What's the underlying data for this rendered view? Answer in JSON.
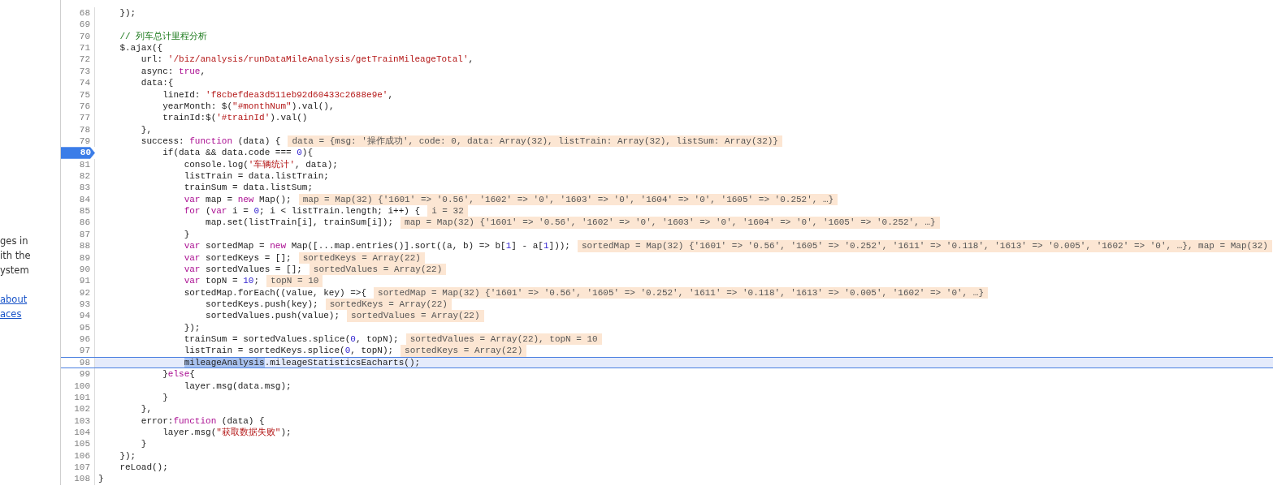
{
  "side_panel": {
    "texts": [
      {
        "kind": "text",
        "text": "ges in"
      },
      {
        "kind": "text",
        "text": "ith the"
      },
      {
        "kind": "text",
        "text": "ystem"
      },
      {
        "kind": "link",
        "text": "about"
      },
      {
        "kind": "link",
        "text": "aces"
      }
    ]
  },
  "editor": {
    "lines": [
      {
        "number": "68",
        "breakpoint": false,
        "current": false,
        "code": [
          {
            "kind": "plain",
            "text": "    });"
          }
        ]
      },
      {
        "number": "69",
        "breakpoint": false,
        "current": false
      },
      {
        "number": "70",
        "breakpoint": false,
        "current": false,
        "code": [
          {
            "kind": "comment",
            "text": "    // 列车总计里程分析"
          }
        ]
      },
      {
        "number": "71",
        "breakpoint": false,
        "current": false,
        "code": [
          {
            "kind": "plain",
            "text": "    $.ajax({"
          }
        ]
      },
      {
        "number": "72",
        "breakpoint": false,
        "current": false,
        "code": [
          {
            "kind": "plain",
            "text": "        url: "
          },
          {
            "kind": "string",
            "text": "'/biz/analysis/runDataMileAnalysis/getTrainMileageTotal'"
          },
          {
            "kind": "plain",
            "text": ","
          }
        ]
      },
      {
        "number": "73",
        "breakpoint": false,
        "current": false,
        "code": [
          {
            "kind": "plain",
            "text": "        async: "
          },
          {
            "kind": "keyword",
            "text": "true"
          },
          {
            "kind": "plain",
            "text": ","
          }
        ]
      },
      {
        "number": "74",
        "breakpoint": false,
        "current": false,
        "code": [
          {
            "kind": "plain",
            "text": "        data:{"
          }
        ]
      },
      {
        "number": "75",
        "breakpoint": false,
        "current": false,
        "code": [
          {
            "kind": "plain",
            "text": "            lineId: "
          },
          {
            "kind": "string",
            "text": "'f8cbefdea3d511eb92d60433c2688e9e'"
          },
          {
            "kind": "plain",
            "text": ","
          }
        ]
      },
      {
        "number": "76",
        "breakpoint": false,
        "current": false,
        "code": [
          {
            "kind": "plain",
            "text": "            yearMonth: $("
          },
          {
            "kind": "string",
            "text": "\"#monthNum\""
          },
          {
            "kind": "plain",
            "text": ").val(),"
          }
        ]
      },
      {
        "number": "77",
        "breakpoint": false,
        "current": false,
        "code": [
          {
            "kind": "plain",
            "text": "            trainId:$("
          },
          {
            "kind": "string",
            "text": "'#trainId'"
          },
          {
            "kind": "plain",
            "text": ").val()"
          }
        ]
      },
      {
        "number": "78",
        "breakpoint": false,
        "current": false,
        "code": [
          {
            "kind": "plain",
            "text": "        },"
          }
        ]
      },
      {
        "number": "79",
        "breakpoint": false,
        "current": false,
        "code": [
          {
            "kind": "plain",
            "text": "        success: "
          },
          {
            "kind": "keyword",
            "text": "function"
          },
          {
            "kind": "plain",
            "text": " (data) {"
          }
        ],
        "value": "data = {msg: '操作成功', code: 0, data: Array(32), listTrain: Array(32), listSum: Array(32)}"
      },
      {
        "number": "80",
        "breakpoint": true,
        "current": false,
        "code": [
          {
            "kind": "plain",
            "text": "            if(data && data.code === "
          },
          {
            "kind": "number",
            "text": "0"
          },
          {
            "kind": "plain",
            "text": "){"
          }
        ]
      },
      {
        "number": "81",
        "breakpoint": false,
        "current": false,
        "code": [
          {
            "kind": "plain",
            "text": "                console.log("
          },
          {
            "kind": "string",
            "text": "'车辆统计'"
          },
          {
            "kind": "plain",
            "text": ", data);"
          }
        ]
      },
      {
        "number": "82",
        "breakpoint": false,
        "current": false,
        "code": [
          {
            "kind": "plain",
            "text": "                listTrain = data.listTrain;"
          }
        ]
      },
      {
        "number": "83",
        "breakpoint": false,
        "current": false,
        "code": [
          {
            "kind": "plain",
            "text": "                trainSum = data.listSum;"
          }
        ]
      },
      {
        "number": "84",
        "breakpoint": false,
        "current": false,
        "code": [
          {
            "kind": "keyword",
            "text": "                var"
          },
          {
            "kind": "plain",
            "text": " map = "
          },
          {
            "kind": "keyword",
            "text": "new"
          },
          {
            "kind": "plain",
            "text": " Map();"
          }
        ],
        "value": "map = Map(32) {'1601' => '0.56', '1602' => '0', '1603' => '0', '1604' => '0', '1605' => '0.252', …}"
      },
      {
        "number": "85",
        "breakpoint": false,
        "current": false,
        "code": [
          {
            "kind": "keyword",
            "text": "                for"
          },
          {
            "kind": "plain",
            "text": " ("
          },
          {
            "kind": "keyword",
            "text": "var"
          },
          {
            "kind": "plain",
            "text": " i = "
          },
          {
            "kind": "number",
            "text": "0"
          },
          {
            "kind": "plain",
            "text": "; i < listTrain.length; i++) {"
          }
        ],
        "value": "i = 32"
      },
      {
        "number": "86",
        "breakpoint": false,
        "current": false,
        "code": [
          {
            "kind": "plain",
            "text": "                    map.set(listTrain[i], trainSum[i]);"
          }
        ],
        "value": "map = Map(32) {'1601' => '0.56', '1602' => '0', '1603' => '0', '1604' => '0', '1605' => '0.252', …}"
      },
      {
        "number": "87",
        "breakpoint": false,
        "current": false,
        "code": [
          {
            "kind": "plain",
            "text": "                }"
          }
        ]
      },
      {
        "number": "88",
        "breakpoint": false,
        "current": false,
        "code": [
          {
            "kind": "keyword",
            "text": "                var"
          },
          {
            "kind": "plain",
            "text": " sortedMap = "
          },
          {
            "kind": "keyword",
            "text": "new"
          },
          {
            "kind": "plain",
            "text": " Map([...map.entries()].sort((a, b) => b["
          },
          {
            "kind": "number",
            "text": "1"
          },
          {
            "kind": "plain",
            "text": "] - a["
          },
          {
            "kind": "number",
            "text": "1"
          },
          {
            "kind": "plain",
            "text": "]));"
          }
        ],
        "value": "sortedMap = Map(32) {'1601' => '0.56', '1605' => '0.252', '1611' => '0.118', '1613' => '0.005', '1602' => '0', …}, map = Map(32)"
      },
      {
        "number": "89",
        "breakpoint": false,
        "current": false,
        "code": [
          {
            "kind": "keyword",
            "text": "                var"
          },
          {
            "kind": "plain",
            "text": " sortedKeys = [];"
          }
        ],
        "value": "sortedKeys = Array(22)"
      },
      {
        "number": "90",
        "breakpoint": false,
        "current": false,
        "code": [
          {
            "kind": "keyword",
            "text": "                var"
          },
          {
            "kind": "plain",
            "text": " sortedValues = [];"
          }
        ],
        "value": "sortedValues = Array(22)"
      },
      {
        "number": "91",
        "breakpoint": false,
        "current": false,
        "code": [
          {
            "kind": "keyword",
            "text": "                var"
          },
          {
            "kind": "plain",
            "text": " topN = "
          },
          {
            "kind": "number",
            "text": "10"
          },
          {
            "kind": "plain",
            "text": ";"
          }
        ],
        "value": "topN = 10"
      },
      {
        "number": "92",
        "breakpoint": false,
        "current": false,
        "code": [
          {
            "kind": "plain",
            "text": "                sortedMap.forEach((value, key) =>{"
          }
        ],
        "value": "sortedMap = Map(32) {'1601' => '0.56', '1605' => '0.252', '1611' => '0.118', '1613' => '0.005', '1602' => '0', …}"
      },
      {
        "number": "93",
        "breakpoint": false,
        "current": false,
        "code": [
          {
            "kind": "plain",
            "text": "                    sortedKeys.push(key);"
          }
        ],
        "value": "sortedKeys = Array(22)"
      },
      {
        "number": "94",
        "breakpoint": false,
        "current": false,
        "code": [
          {
            "kind": "plain",
            "text": "                    sortedValues.push(value);"
          }
        ],
        "value": "sortedValues = Array(22)"
      },
      {
        "number": "95",
        "breakpoint": false,
        "current": false,
        "code": [
          {
            "kind": "plain",
            "text": "                });"
          }
        ]
      },
      {
        "number": "96",
        "breakpoint": false,
        "current": false,
        "code": [
          {
            "kind": "plain",
            "text": "                trainSum = sortedValues.splice("
          },
          {
            "kind": "number",
            "text": "0"
          },
          {
            "kind": "plain",
            "text": ", topN);"
          }
        ],
        "value": "sortedValues = Array(22), topN = 10"
      },
      {
        "number": "97",
        "breakpoint": false,
        "current": false,
        "code": [
          {
            "kind": "plain",
            "text": "                listTrain = sortedKeys.splice("
          },
          {
            "kind": "number",
            "text": "0"
          },
          {
            "kind": "plain",
            "text": ", topN);"
          }
        ],
        "value": "sortedKeys = Array(22)"
      },
      {
        "number": "98",
        "breakpoint": false,
        "current": true,
        "code": [
          {
            "kind": "selection",
            "text": "                mileageAnalysis"
          },
          {
            "kind": "plain",
            "text": ".mileageStatisticsEacharts();"
          }
        ]
      },
      {
        "number": "99",
        "breakpoint": false,
        "current": false,
        "code": [
          {
            "kind": "plain",
            "text": "            }"
          },
          {
            "kind": "keyword",
            "text": "else"
          },
          {
            "kind": "plain",
            "text": "{"
          }
        ]
      },
      {
        "number": "100",
        "breakpoint": false,
        "current": false,
        "code": [
          {
            "kind": "plain",
            "text": "                layer.msg(data.msg);"
          }
        ]
      },
      {
        "number": "101",
        "breakpoint": false,
        "current": false,
        "code": [
          {
            "kind": "plain",
            "text": "            }"
          }
        ]
      },
      {
        "number": "102",
        "breakpoint": false,
        "current": false,
        "code": [
          {
            "kind": "plain",
            "text": "        },"
          }
        ]
      },
      {
        "number": "103",
        "breakpoint": false,
        "current": false,
        "code": [
          {
            "kind": "plain",
            "text": "        error:"
          },
          {
            "kind": "keyword",
            "text": "function"
          },
          {
            "kind": "plain",
            "text": " (data) {"
          }
        ]
      },
      {
        "number": "104",
        "breakpoint": false,
        "current": false,
        "code": [
          {
            "kind": "plain",
            "text": "            layer.msg("
          },
          {
            "kind": "string",
            "text": "\"获取数据失败\""
          },
          {
            "kind": "plain",
            "text": ");"
          }
        ]
      },
      {
        "number": "105",
        "breakpoint": false,
        "current": false,
        "code": [
          {
            "kind": "plain",
            "text": "        }"
          }
        ]
      },
      {
        "number": "106",
        "breakpoint": false,
        "current": false,
        "code": [
          {
            "kind": "plain",
            "text": "    });"
          }
        ]
      },
      {
        "number": "107",
        "breakpoint": false,
        "current": false,
        "code": [
          {
            "kind": "plain",
            "text": "    reLoad();"
          }
        ]
      },
      {
        "number": "108",
        "breakpoint": false,
        "current": false,
        "code": [
          {
            "kind": "plain",
            "text": "}"
          }
        ]
      }
    ]
  }
}
